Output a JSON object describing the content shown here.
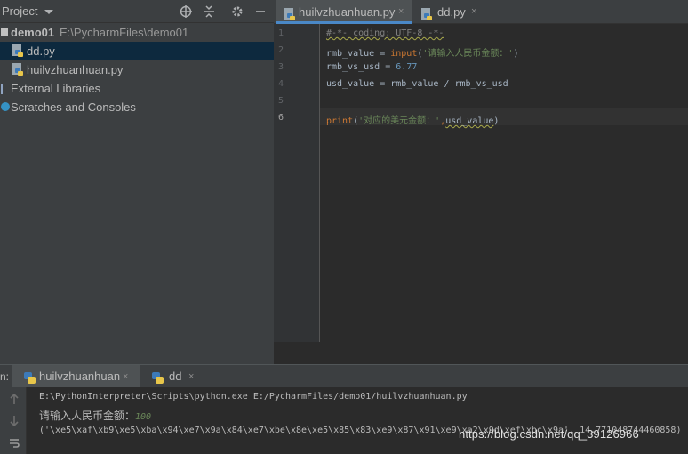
{
  "project_panel": {
    "title": "Project",
    "tree": [
      {
        "name": "demo01",
        "path": "E:\\PycharmFiles\\demo01"
      },
      {
        "name": "dd.py"
      },
      {
        "name": "huilvzhuanhuan.py"
      },
      {
        "name": "External Libraries"
      },
      {
        "name": "Scratches and Consoles"
      }
    ]
  },
  "editor": {
    "tabs": [
      {
        "label": "huilvzhuanhuan.py",
        "close": "×"
      },
      {
        "label": "dd.py",
        "close": "×"
      }
    ],
    "line_numbers": [
      "1",
      "2",
      "3",
      "4",
      "5",
      "6"
    ],
    "code": {
      "l1": "#-*- coding: UTF-8 -*-",
      "l2_var": "rmb_value = ",
      "l2_fn": "input",
      "l2_open": "(",
      "l2_str": "'请输入人民币金额：'",
      "l2_close": ")",
      "l3_var": "rmb_vs_usd = ",
      "l3_num": "6.77",
      "l4": "usd_value = rmb_value / rmb_vs_usd",
      "l6_fn": "print",
      "l6_open": "(",
      "l6_str": "'对应的美元金额：'",
      "l6_comma": ",",
      "l6_arg": "usd_value",
      "l6_close": ")"
    }
  },
  "run_panel": {
    "prefix": "n:",
    "tabs": [
      {
        "label": "huilvzhuanhuan",
        "close": "×"
      },
      {
        "label": "dd",
        "close": "×"
      }
    ],
    "console": {
      "command": "E:\\PythonInterpreter\\Scripts\\python.exe E:/PycharmFiles/demo01/huilvzhuanhuan.py",
      "prompt": "请输入人民币金额：",
      "input": "100",
      "output": "('\\xe5\\xaf\\xb9\\xe5\\xba\\x94\\xe7\\x9a\\x84\\xe7\\xbe\\x8e\\xe5\\x85\\x83\\xe9\\x87\\x91\\xe9\\xa2\\x9d\\xef\\xbc\\x9a', 14.771048744460858)"
    }
  },
  "watermark": "https://blog.csdn.net/qq_39126966",
  "colors": {
    "background": "#2b2b2b",
    "panel": "#3c3f41",
    "selection": "#0d293e",
    "keyword": "#cc7832",
    "string": "#6a8759",
    "number": "#6897bb",
    "comment": "#808080"
  }
}
